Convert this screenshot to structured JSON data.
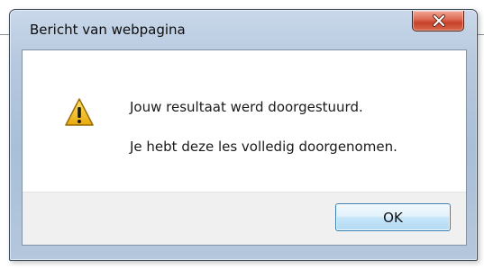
{
  "window": {
    "title": "Bericht van webpagina"
  },
  "message": {
    "line1": "Jouw resultaat werd doorgestuurd.",
    "line2": "Je hebt deze les volledig doorgenomen."
  },
  "buttons": {
    "ok_label": "OK"
  },
  "icons": {
    "close": "close-icon",
    "warning": "warning-icon"
  },
  "colors": {
    "close_button": "#c8422a",
    "ok_button_border": "#3c7fb1",
    "warning_fill": "#f6c21a"
  }
}
